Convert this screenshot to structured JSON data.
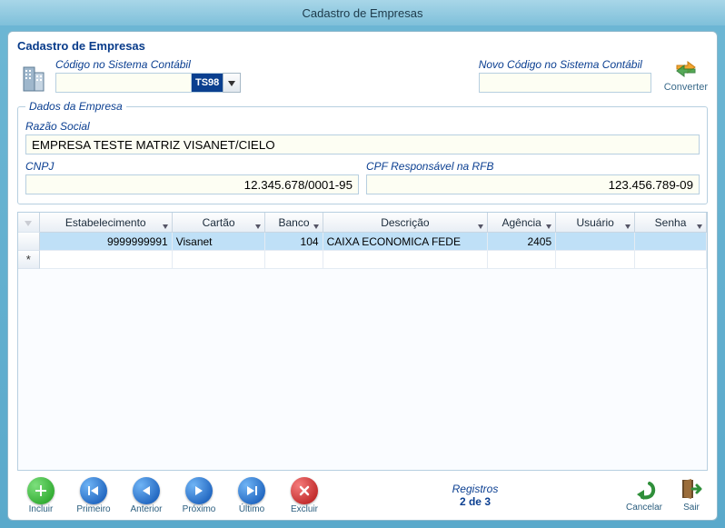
{
  "window": {
    "title": "Cadastro de Empresas"
  },
  "panel": {
    "title": "Cadastro de Empresas"
  },
  "top": {
    "codigo_label": "Código no Sistema Contábil",
    "codigo_value": "",
    "codigo_badge": "TS98",
    "novo_codigo_label": "Novo Código no Sistema Contábil",
    "novo_codigo_value": "",
    "converter_label": "Converter"
  },
  "dados": {
    "legend": "Dados da Empresa",
    "razao_label": "Razão Social",
    "razao_value": "EMPRESA TESTE MATRIZ VISANET/CIELO",
    "cnpj_label": "CNPJ",
    "cnpj_value": "12.345.678/0001-95",
    "cpf_label": "CPF Responsável na RFB",
    "cpf_value": "123.456.789-09"
  },
  "grid": {
    "headers": {
      "estab": "Estabelecimento",
      "cartao": "Cartão",
      "banco": "Banco",
      "desc": "Descrição",
      "agencia": "Agência",
      "usuario": "Usuário",
      "senha": "Senha"
    },
    "rows": [
      {
        "estab": "9999999991",
        "cartao": "Visanet",
        "banco": "104",
        "desc": "CAIXA ECONOMICA FEDE",
        "agencia": "2405",
        "usuario": "",
        "senha": ""
      }
    ]
  },
  "nav": {
    "incluir": "Incluir",
    "primeiro": "Primeiro",
    "anterior": "Anterior",
    "proximo": "Próximo",
    "ultimo": "Último",
    "excluir": "Excluir"
  },
  "registros": {
    "label": "Registros",
    "count": "2 de 3"
  },
  "actions": {
    "cancelar": "Cancelar",
    "sair": "Sair"
  }
}
